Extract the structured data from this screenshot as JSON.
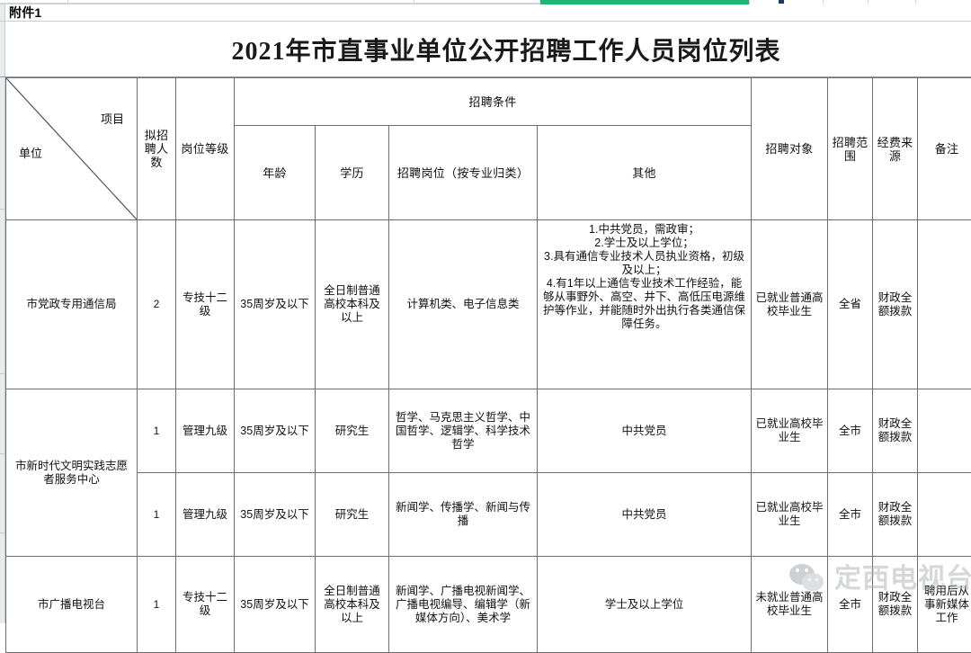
{
  "window": {
    "attachment_label": "附件1",
    "selection_bar_color": "#21b573",
    "gridline_color": "#6e6e6e"
  },
  "document": {
    "title": "2021年市直事业单位公开招聘工作人员岗位列表"
  },
  "table": {
    "corner": {
      "row_label": "项目",
      "col_label": "单位"
    },
    "headers": {
      "unit": "单位",
      "item": "项目",
      "count": "拟招聘人数",
      "level": "岗位等级",
      "conditions_group": "招聘条件",
      "age": "年龄",
      "education": "学历",
      "major": "招聘岗位（按专业归类）",
      "other": "其他",
      "target": "招聘对象",
      "scope": "招聘范围",
      "funding": "经费来源",
      "remark": "备注"
    },
    "rows": [
      {
        "unit": "市党政专用通信局",
        "count": "2",
        "level": "专技十二级",
        "age": "35周岁及以下",
        "education": "全日制普通高校本科及以上",
        "major": "计算机类、电子信息类",
        "other": "1.中共党员，需政审；\n2.学士及以上学位；\n3.具有通信专业技术人员执业资格，初级及以上；\n4.有1年以上通信专业技术工作经验，能够从事野外、高空、井下、高低压电源维护等作业，并能随时外出执行各类通信保障任务。",
        "target": "已就业普通高校毕业生",
        "scope": "全省",
        "funding": "财政全额拨款",
        "remark": ""
      },
      {
        "unit": "市新时代文明实践志愿者服务中心",
        "unit_rowspan": 2,
        "count": "1",
        "level": "管理九级",
        "age": "35周岁及以下",
        "education": "研究生",
        "major": "哲学、马克思主义哲学、中国哲学、逻辑学、科学技术哲学",
        "other": "中共党员",
        "target": "已就业高校毕业生",
        "scope": "全市",
        "funding": "财政全额拨款",
        "remark": ""
      },
      {
        "unit": "",
        "count": "1",
        "level": "管理九级",
        "age": "35周岁及以下",
        "education": "研究生",
        "major": "新闻学、传播学、新闻与传播",
        "other": "中共党员",
        "target": "已就业高校毕业生",
        "scope": "全市",
        "funding": "财政全额拨款",
        "remark": ""
      },
      {
        "unit": "市广播电视台",
        "count": "1",
        "level": "专技十二级",
        "age": "35周岁及以下",
        "education": "全日制普通高校本科及以上",
        "major": "新闻学、广播电视新闻学、广播电视编导、编辑学（新媒体方向）、美术学",
        "other": "学士及以上学位",
        "target": "未就业普通高校毕业生",
        "scope": "全市",
        "funding": "财政全额拨款",
        "remark": "聘用后从事新媒体工作"
      }
    ]
  },
  "watermark": {
    "text": "定西电视台",
    "icon": "wechat-icon",
    "color": "#a9adb1"
  }
}
